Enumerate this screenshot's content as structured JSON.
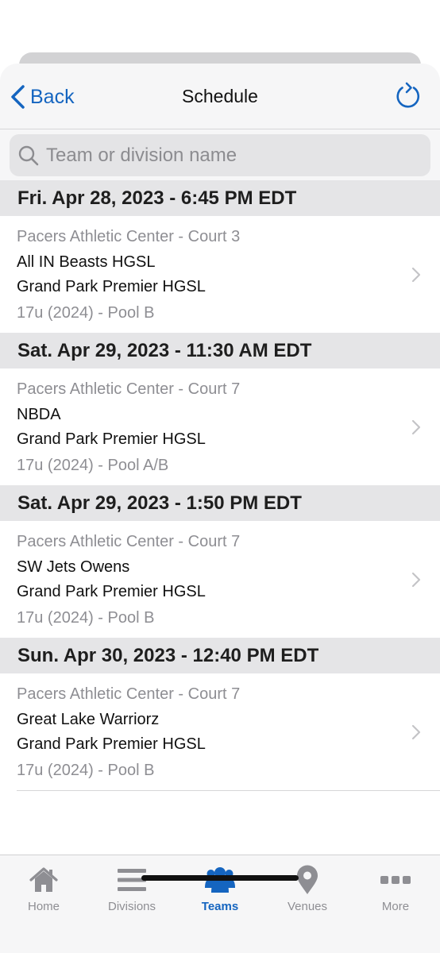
{
  "colors": {
    "accent": "#1565c0",
    "secondary_text": "#8e8e93",
    "section_bg": "#e5e5e7"
  },
  "nav": {
    "back_label": "Back",
    "title": "Schedule",
    "back_icon": "chevron-left-icon",
    "refresh_icon": "refresh-icon"
  },
  "search": {
    "placeholder": "Team or division name",
    "value": "",
    "icon": "search-icon"
  },
  "games": [
    {
      "date": "Fri. Apr 28, 2023 - 6:45 PM EDT",
      "venue": "Pacers Athletic Center - Court 3",
      "team1": "All IN Beasts HGSL",
      "team2": "Grand Park Premier HGSL",
      "division": "17u (2024) - Pool B"
    },
    {
      "date": "Sat. Apr 29, 2023 - 11:30 AM EDT",
      "venue": "Pacers Athletic Center - Court 7",
      "team1": "NBDA",
      "team2": "Grand Park Premier HGSL",
      "division": "17u (2024) - Pool A/B"
    },
    {
      "date": "Sat. Apr 29, 2023 - 1:50 PM EDT",
      "venue": "Pacers Athletic Center - Court 7",
      "team1": "SW Jets Owens",
      "team2": "Grand Park Premier HGSL",
      "division": "17u (2024) - Pool B"
    },
    {
      "date": "Sun. Apr 30, 2023 - 12:40 PM EDT",
      "venue": "Pacers Athletic Center - Court 7",
      "team1": "Great Lake Warriorz",
      "team2": "Grand Park Premier HGSL",
      "division": "17u (2024) - Pool B"
    }
  ],
  "tabs": [
    {
      "label": "Home",
      "icon": "home-icon",
      "active": false
    },
    {
      "label": "Divisions",
      "icon": "list-icon",
      "active": false
    },
    {
      "label": "Teams",
      "icon": "people-icon",
      "active": true
    },
    {
      "label": "Venues",
      "icon": "map-pin-icon",
      "active": false
    },
    {
      "label": "More",
      "icon": "ellipsis-icon",
      "active": false
    }
  ]
}
